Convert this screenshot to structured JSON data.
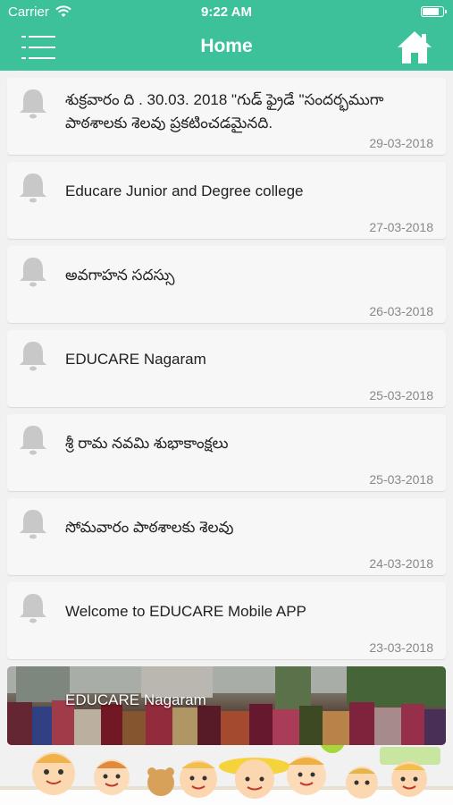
{
  "status_bar": {
    "carrier": "Carrier",
    "time": "9:22 AM",
    "battery_level": 0.75
  },
  "header": {
    "title": "Home",
    "menu_icon": "hamburger-menu-icon",
    "home_icon": "home-icon"
  },
  "colors": {
    "accent": "#3cc19a",
    "card_bg": "#f7f7f7",
    "page_bg": "#f1f1f1",
    "bell": "#c8c8c8",
    "date": "#888888"
  },
  "notifications": [
    {
      "text": "శుక్రవారం ది . 30.03. 2018 \"గుడ్ ఫ్రైడే \"సందర్భముగా పాఠశాలకు శెలవు ప్రకటించడమైనది.",
      "date": "29-03-2018"
    },
    {
      "text": "Educare Junior and Degree college",
      "date": "27-03-2018"
    },
    {
      "text": "అవగాహన సదస్సు",
      "date": "26-03-2018"
    },
    {
      "text": "EDUCARE Nagaram",
      "date": "25-03-2018"
    },
    {
      "text": "శ్రీ రామ నవమి శుభాకాంక్షలు",
      "date": "25-03-2018"
    },
    {
      "text": "సోమవారం పాఠశాలకు శెలవు",
      "date": "24-03-2018"
    },
    {
      "text": "Welcome to EDUCARE Mobile APP",
      "date": "23-03-2018"
    }
  ],
  "banner": {
    "label": "EDUCARE Nagaram"
  }
}
